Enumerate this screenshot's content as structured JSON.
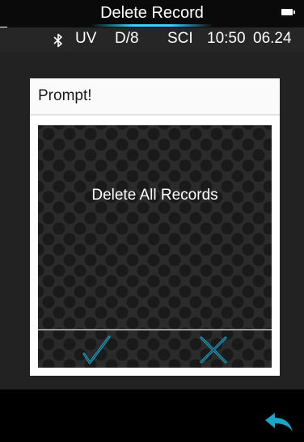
{
  "header": {
    "title": "Delete Record"
  },
  "status": {
    "uv": "UV",
    "geometry": "D/8",
    "mode": "SCI",
    "time": "10:50",
    "date": "06.24"
  },
  "dialog": {
    "title": "Prompt!",
    "message": "Delete All Records"
  },
  "icons": {
    "battery": "battery-icon",
    "bluetooth": "bluetooth-icon",
    "confirm": "checkmark-icon",
    "cancel": "x-icon",
    "back": "back-arrow-icon"
  },
  "colors": {
    "accent": "#1aa6c8",
    "dialog_bg": "#ffffff",
    "body_bg": "#222222"
  }
}
